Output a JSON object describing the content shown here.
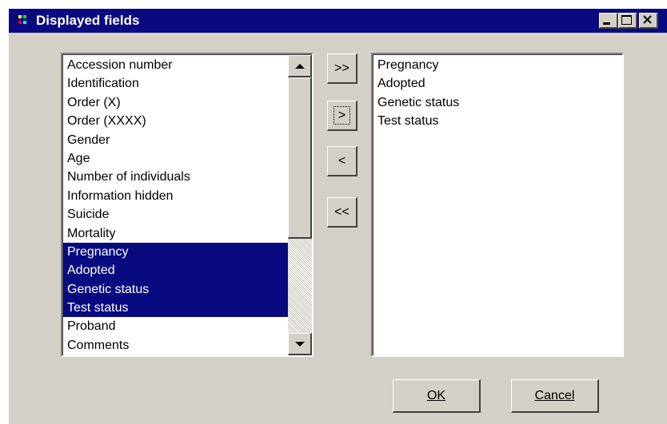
{
  "window": {
    "title": "Displayed fields",
    "controls": {
      "minimize": "minimize",
      "maximize": "maximize",
      "close": "close"
    }
  },
  "available_list": {
    "items": [
      {
        "label": "Accession number",
        "selected": false
      },
      {
        "label": "Identification",
        "selected": false
      },
      {
        "label": "Order (X)",
        "selected": false
      },
      {
        "label": "Order (XXXX)",
        "selected": false
      },
      {
        "label": "Gender",
        "selected": false
      },
      {
        "label": "Age",
        "selected": false
      },
      {
        "label": "Number of individuals",
        "selected": false
      },
      {
        "label": "Information hidden",
        "selected": false
      },
      {
        "label": "Suicide",
        "selected": false
      },
      {
        "label": "Mortality",
        "selected": false
      },
      {
        "label": "Pregnancy",
        "selected": true
      },
      {
        "label": "Adopted",
        "selected": true
      },
      {
        "label": "Genetic status",
        "selected": true
      },
      {
        "label": "Test status",
        "selected": true
      },
      {
        "label": "Proband",
        "selected": false
      },
      {
        "label": "Comments",
        "selected": false
      }
    ]
  },
  "move_buttons": {
    "add_all": ">>",
    "add": ">",
    "remove": "<",
    "remove_all": "<<"
  },
  "displayed_list": {
    "items": [
      "Pregnancy",
      "Adopted",
      "Genetic status",
      "Test status"
    ]
  },
  "dialog_buttons": {
    "ok": "OK",
    "cancel": "Cancel"
  },
  "colors": {
    "titlebar": "#0a0a80",
    "selection": "#0a0a80",
    "face": "#d4d0c8"
  }
}
